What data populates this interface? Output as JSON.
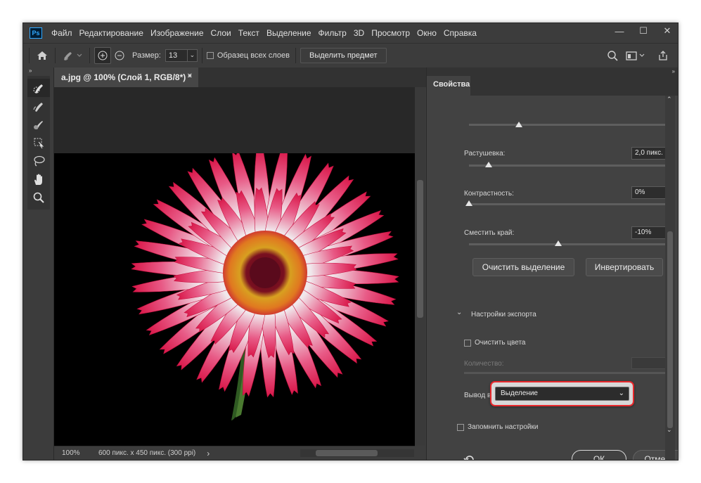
{
  "app": {
    "logo": "Ps"
  },
  "menu": [
    "Файл",
    "Редактирование",
    "Изображение",
    "Слои",
    "Текст",
    "Выделение",
    "Фильтр",
    "3D",
    "Просмотр",
    "Окно",
    "Справка"
  ],
  "window_controls": {
    "minimize": "—",
    "maximize": "☐",
    "close": "✕"
  },
  "options_bar": {
    "size_label": "Размер:",
    "size_value": "13",
    "sample_all_layers_label": "Образец всех слоев",
    "select_subject_label": "Выделить предмет"
  },
  "document": {
    "tab_title": "a.jpg @ 100% (Слой 1, RGB/8*) *",
    "close_glyph": "✕",
    "zoom": "100%",
    "dimensions": "600 пикс. x 450 пикс. (300 ppi)",
    "status_arrow": "›"
  },
  "panel": {
    "title": "Свойства",
    "feather_label": "Растушевка:",
    "feather_value": "2,0 пикс.",
    "contrast_label": "Контрастность:",
    "contrast_value": "0%",
    "shift_edge_label": "Сместить край:",
    "shift_edge_value": "-10%",
    "clear_selection_button": "Очистить выделение",
    "invert_button": "Инвертировать",
    "export_section_title": "Настройки экспорта",
    "decontaminate_label": "Очистить цвета",
    "amount_label": "Количество:",
    "output_to_label": "Вывод в:",
    "output_to_value": "Выделение",
    "remember_label": "Запомнить настройки",
    "ok_button": "ОК",
    "cancel_button": "Отмена"
  },
  "levels": {
    "top_slider": 0.25,
    "feather": 0.1,
    "contrast": 0.0,
    "shift_edge": 0.45
  },
  "colors": {
    "accent_highlight": "#e8282c",
    "ps_blue": "#31a8ff"
  }
}
